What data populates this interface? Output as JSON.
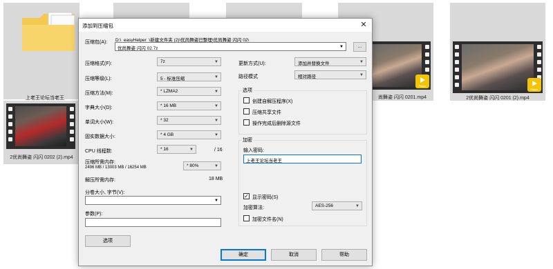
{
  "background": {
    "tiles": [
      {
        "label": "上老王论坛当老王"
      },
      {
        "label": "2优尚舞姿 闪闪 0202 (2).mp4"
      },
      {
        "label": "尚舞姿 闪闪 0201.mp4"
      },
      {
        "label": "2优尚舞姿 闪闪 0201 (2).mp4"
      }
    ],
    "player_badge": "Player"
  },
  "dialog": {
    "title": "添加到压缩包",
    "archive_label": "压缩包(A):",
    "archive_path": "D:\\_easyHelper_\\新建文件夹 (2)\\优尚舞姿已整理\\优尚舞姿 闪闪 02\\",
    "archive_name": "优尚舞姿 闪闪 02.7z",
    "browse_label": "...",
    "format_label": "压缩格式(F):",
    "format_value": "7z",
    "level_label": "压缩等级(L):",
    "level_value": "5 - 标准压缩",
    "method_label": "压缩方法(M):",
    "method_value": "* LZMA2",
    "dict_label": "字典大小(D):",
    "dict_value": "* 16 MB",
    "word_label": "单词大小(W):",
    "word_value": "* 32",
    "solid_label": "固实数据大小:",
    "solid_value": "* 4 GB",
    "cpu_label": "CPU 线程数:",
    "cpu_value": "* 16",
    "cpu_total": "/ 16",
    "mem_comp_label": "压缩所需内存:",
    "mem_comp_detail": "2496 MB / 13003 MB / 16254 MB",
    "mem_comp_value": "* 80%",
    "mem_decomp_label": "解压所需内存:",
    "mem_decomp_value": "18 MB",
    "split_label": "分卷大小, 字节(V):",
    "split_value": "",
    "params_label": "参数(P):",
    "params_value": "",
    "options_button": "选项",
    "update_label": "更新方式(U):",
    "update_value": "添加并替换文件",
    "path_label": "路径模式",
    "path_value": "相对路径",
    "options_group": "选项",
    "opt_sfx": "创建自解压程序(X)",
    "opt_shared": "压缩共享文件",
    "opt_delete": "操作完成后删除源文件",
    "encrypt_group": "加密",
    "password_label": "输入密码:",
    "password_value": "上老王论坛当老王",
    "show_password": "显示密码(S)",
    "enc_method_label": "加密算法:",
    "enc_method_value": "AES-256",
    "encrypt_names": "加密文件名(N)",
    "ok_button": "确定",
    "cancel_button": "取消",
    "help_button": "帮助",
    "checkbox_checked_glyph": "✓",
    "show_password_checked": true
  }
}
